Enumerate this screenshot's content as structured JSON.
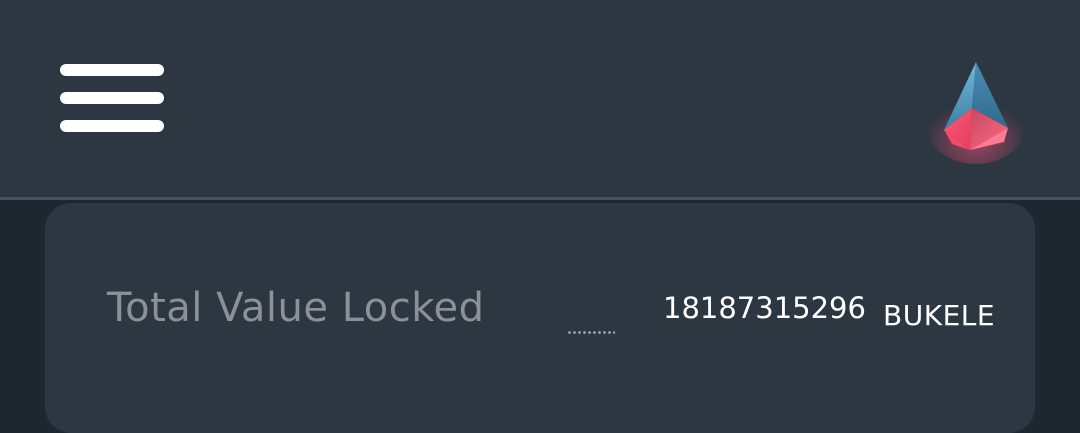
{
  "header": {
    "menu_icon": "hamburger-menu-icon",
    "logo_icon": "crystal-gem-logo-icon"
  },
  "tvl": {
    "label": "Total Value Locked",
    "value": "18187315296",
    "unit": "BUKELE"
  },
  "colors": {
    "header_bg": "#2d3741",
    "page_bg": "#1e2730",
    "card_bg": "#2d3741",
    "divider": "#4a4e66",
    "label_text": "#8b9196",
    "value_text": "#ffffff",
    "logo_blue": "#5fa6c8",
    "logo_pink": "#f0506e"
  }
}
